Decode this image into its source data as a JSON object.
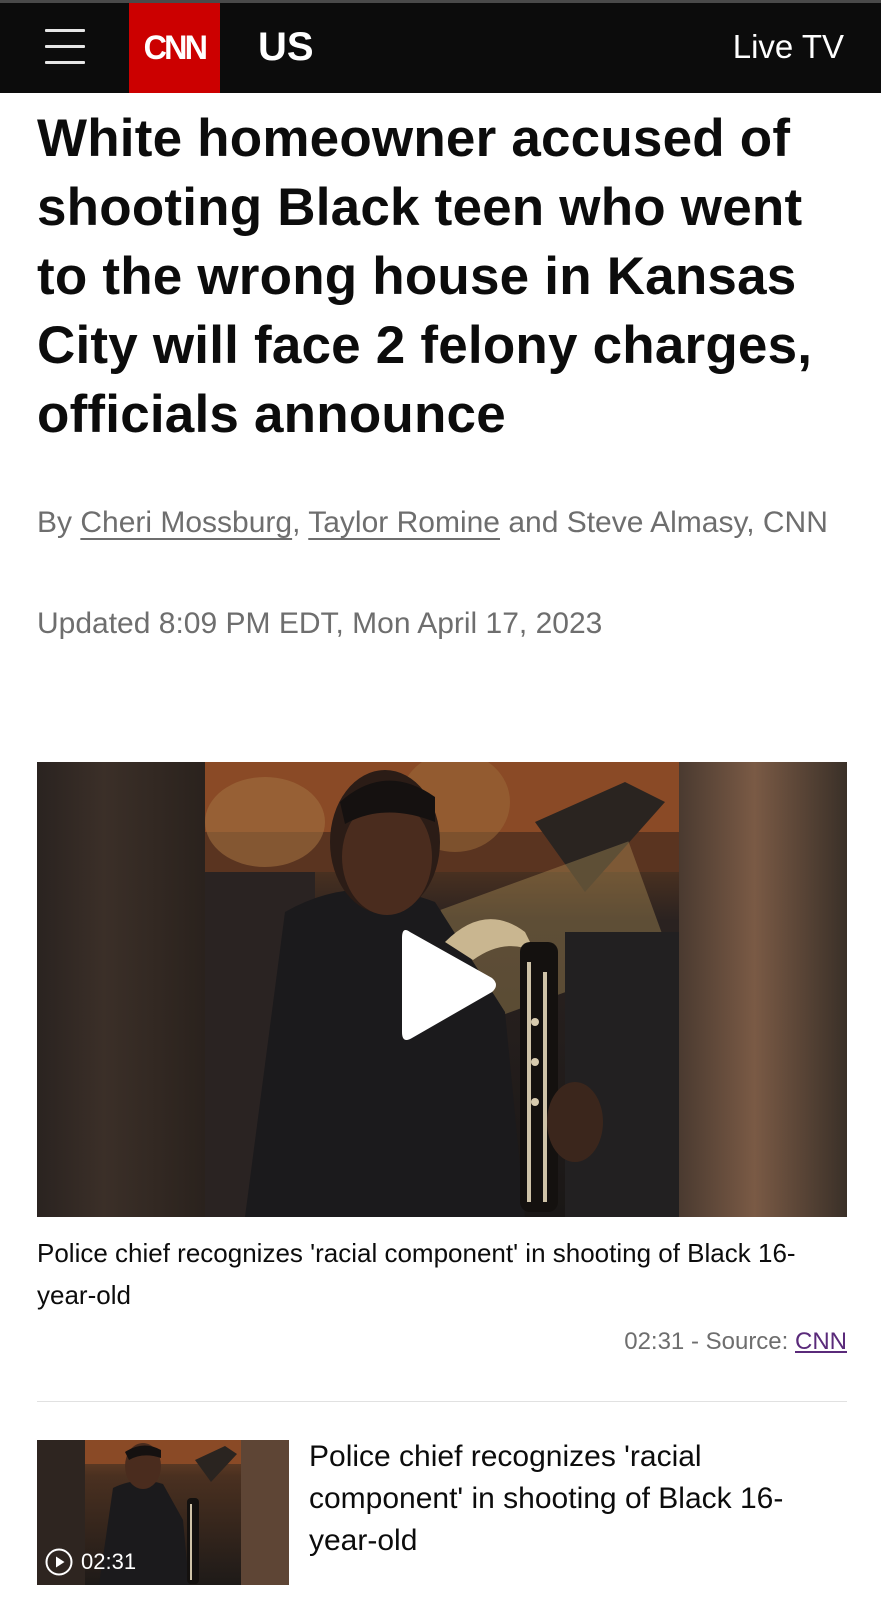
{
  "header": {
    "menu_icon": "hamburger-menu-icon",
    "logo_text": "CNN",
    "section": "US",
    "live_tv": "Live TV",
    "colors": {
      "background": "#0c0c0c",
      "logo_red": "#cc0000"
    }
  },
  "article": {
    "headline": "White homeowner accused of shooting Black teen who went to the wrong house in Kansas City will face 2 felony charges, officials announce",
    "byline": {
      "prefix": "By ",
      "authors": [
        "Cheri Mossburg",
        "Taylor Romine"
      ],
      "separator": ", ",
      "connector": " and Steve Almasy, CNN"
    },
    "updated": "Updated 8:09 PM EDT, Mon April 17, 2023"
  },
  "video": {
    "play_icon": "play-icon",
    "caption": "Police chief recognizes 'racial component' in shooting of Black 16-year-old",
    "duration": "02:31",
    "source_prefix": " - Source: ",
    "source": "CNN"
  },
  "related": {
    "duration": "02:31",
    "play_icon": "play-circle-icon",
    "title": "Police chief recognizes 'racial component' in shooting of Black 16-year-old"
  }
}
